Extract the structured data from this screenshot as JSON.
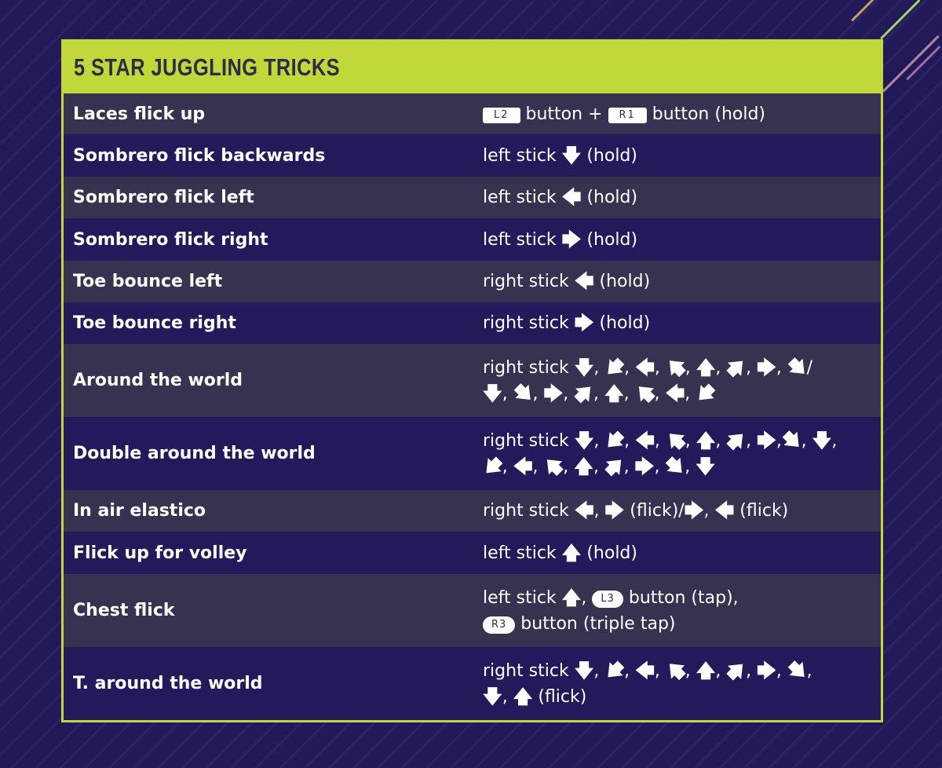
{
  "title": "5 STAR JUGGLING TRICKS",
  "colors": {
    "accent": "#c2d83a",
    "row_odd": "#363250",
    "row_even": "#221a5a",
    "background": "#221a58",
    "title_text": "#2f2c4a"
  },
  "arrows": {
    "down": "🡇",
    "up": "🡅",
    "left": "🡄",
    "right": "🡆",
    "down_left": "🡇",
    "up_left": "🡄",
    "up_right": "🡅",
    "down_right": "🡆"
  },
  "rows": [
    {
      "name": "Laces flick up",
      "input": [
        [
          {
            "t": "btn",
            "v": "L2"
          },
          {
            "t": "txt",
            "v": " button + "
          },
          {
            "t": "btn",
            "v": "R1"
          },
          {
            "t": "txt",
            "v": " button (hold)"
          }
        ]
      ]
    },
    {
      "name": "Sombrero flick backwards",
      "input": [
        [
          {
            "t": "txt",
            "v": "left stick "
          },
          {
            "t": "arr",
            "v": "down"
          },
          {
            "t": "txt",
            "v": " (hold)"
          }
        ]
      ]
    },
    {
      "name": "Sombrero flick left",
      "input": [
        [
          {
            "t": "txt",
            "v": "left stick "
          },
          {
            "t": "arr",
            "v": "left"
          },
          {
            "t": "txt",
            "v": " (hold)"
          }
        ]
      ]
    },
    {
      "name": "Sombrero flick right",
      "input": [
        [
          {
            "t": "txt",
            "v": "left stick "
          },
          {
            "t": "arr",
            "v": "right"
          },
          {
            "t": "txt",
            "v": " (hold)"
          }
        ]
      ]
    },
    {
      "name": "Toe bounce left",
      "input": [
        [
          {
            "t": "txt",
            "v": "right stick "
          },
          {
            "t": "arr",
            "v": "left"
          },
          {
            "t": "txt",
            "v": " (hold)"
          }
        ]
      ]
    },
    {
      "name": "Toe bounce right",
      "input": [
        [
          {
            "t": "txt",
            "v": "right stick "
          },
          {
            "t": "arr",
            "v": "right"
          },
          {
            "t": "txt",
            "v": " (hold)"
          }
        ]
      ]
    },
    {
      "name": "Around the world",
      "input": [
        [
          {
            "t": "txt",
            "v": "right stick "
          },
          {
            "t": "arr",
            "v": "down"
          },
          {
            "t": "txt",
            "v": ", "
          },
          {
            "t": "arr",
            "v": "down_left"
          },
          {
            "t": "txt",
            "v": ", "
          },
          {
            "t": "arr",
            "v": "left"
          },
          {
            "t": "txt",
            "v": ", "
          },
          {
            "t": "arr",
            "v": "up_left"
          },
          {
            "t": "txt",
            "v": ", "
          },
          {
            "t": "arr",
            "v": "up"
          },
          {
            "t": "txt",
            "v": ", "
          },
          {
            "t": "arr",
            "v": "up_right"
          },
          {
            "t": "txt",
            "v": ", "
          },
          {
            "t": "arr",
            "v": "right"
          },
          {
            "t": "txt",
            "v": ", "
          },
          {
            "t": "arr",
            "v": "down_right"
          },
          {
            "t": "txt",
            "v": "/"
          }
        ],
        [
          {
            "t": "arr",
            "v": "down"
          },
          {
            "t": "txt",
            "v": ", "
          },
          {
            "t": "arr",
            "v": "down_right"
          },
          {
            "t": "txt",
            "v": ", "
          },
          {
            "t": "arr",
            "v": "right"
          },
          {
            "t": "txt",
            "v": ", "
          },
          {
            "t": "arr",
            "v": "up_right"
          },
          {
            "t": "txt",
            "v": ", "
          },
          {
            "t": "arr",
            "v": "up"
          },
          {
            "t": "txt",
            "v": ", "
          },
          {
            "t": "arr",
            "v": "up_left"
          },
          {
            "t": "txt",
            "v": ", "
          },
          {
            "t": "arr",
            "v": "left"
          },
          {
            "t": "txt",
            "v": ", "
          },
          {
            "t": "arr",
            "v": "down_left"
          }
        ]
      ]
    },
    {
      "name": "Double around the world",
      "input": [
        [
          {
            "t": "txt",
            "v": "right stick "
          },
          {
            "t": "arr",
            "v": "down"
          },
          {
            "t": "txt",
            "v": ", "
          },
          {
            "t": "arr",
            "v": "down_left"
          },
          {
            "t": "txt",
            "v": ", "
          },
          {
            "t": "arr",
            "v": "left"
          },
          {
            "t": "txt",
            "v": ", "
          },
          {
            "t": "arr",
            "v": "up_left"
          },
          {
            "t": "txt",
            "v": ", "
          },
          {
            "t": "arr",
            "v": "up"
          },
          {
            "t": "txt",
            "v": ", "
          },
          {
            "t": "arr",
            "v": "up_right"
          },
          {
            "t": "txt",
            "v": ", "
          },
          {
            "t": "arr",
            "v": "right"
          },
          {
            "t": "txt",
            "v": ","
          },
          {
            "t": "arr",
            "v": "down_right"
          },
          {
            "t": "txt",
            "v": ", "
          },
          {
            "t": "arr",
            "v": "down"
          },
          {
            "t": "txt",
            "v": ","
          }
        ],
        [
          {
            "t": "arr",
            "v": "down_left"
          },
          {
            "t": "txt",
            "v": ", "
          },
          {
            "t": "arr",
            "v": "left"
          },
          {
            "t": "txt",
            "v": ", "
          },
          {
            "t": "arr",
            "v": "up_left"
          },
          {
            "t": "txt",
            "v": ", "
          },
          {
            "t": "arr",
            "v": "up"
          },
          {
            "t": "txt",
            "v": ", "
          },
          {
            "t": "arr",
            "v": "up_right"
          },
          {
            "t": "txt",
            "v": ", "
          },
          {
            "t": "arr",
            "v": "right"
          },
          {
            "t": "txt",
            "v": ", "
          },
          {
            "t": "arr",
            "v": "down_right"
          },
          {
            "t": "txt",
            "v": ", "
          },
          {
            "t": "arr",
            "v": "down"
          }
        ]
      ]
    },
    {
      "name": "In air elastico",
      "input": [
        [
          {
            "t": "txt",
            "v": "right stick "
          },
          {
            "t": "arr",
            "v": "left"
          },
          {
            "t": "txt",
            "v": ", "
          },
          {
            "t": "arr",
            "v": "right"
          },
          {
            "t": "txt",
            "v": " (flick)/"
          },
          {
            "t": "arr",
            "v": "right"
          },
          {
            "t": "txt",
            "v": ", "
          },
          {
            "t": "arr",
            "v": "left"
          },
          {
            "t": "txt",
            "v": " (flick)"
          }
        ]
      ]
    },
    {
      "name": "Flick up for volley",
      "input": [
        [
          {
            "t": "txt",
            "v": "left stick "
          },
          {
            "t": "arr",
            "v": "up"
          },
          {
            "t": "txt",
            "v": " (hold)"
          }
        ]
      ]
    },
    {
      "name": "Chest flick",
      "input": [
        [
          {
            "t": "txt",
            "v": "left stick "
          },
          {
            "t": "arr",
            "v": "up"
          },
          {
            "t": "txt",
            "v": ", "
          },
          {
            "t": "pill",
            "v": "L3"
          },
          {
            "t": "txt",
            "v": " button (tap),"
          }
        ],
        [
          {
            "t": "pill",
            "v": "R3"
          },
          {
            "t": "txt",
            "v": " button (triple tap)"
          }
        ]
      ]
    },
    {
      "name": "T. around the world",
      "input": [
        [
          {
            "t": "txt",
            "v": "right stick "
          },
          {
            "t": "arr",
            "v": "down"
          },
          {
            "t": "txt",
            "v": ", "
          },
          {
            "t": "arr",
            "v": "down_left"
          },
          {
            "t": "txt",
            "v": ", "
          },
          {
            "t": "arr",
            "v": "left"
          },
          {
            "t": "txt",
            "v": ", "
          },
          {
            "t": "arr",
            "v": "up_left"
          },
          {
            "t": "txt",
            "v": ", "
          },
          {
            "t": "arr",
            "v": "up"
          },
          {
            "t": "txt",
            "v": ", "
          },
          {
            "t": "arr",
            "v": "up_right"
          },
          {
            "t": "txt",
            "v": ", "
          },
          {
            "t": "arr",
            "v": "right"
          },
          {
            "t": "txt",
            "v": ", "
          },
          {
            "t": "arr",
            "v": "down_right"
          },
          {
            "t": "txt",
            "v": ","
          }
        ],
        [
          {
            "t": "arr",
            "v": "down"
          },
          {
            "t": "txt",
            "v": ", "
          },
          {
            "t": "arr",
            "v": "up"
          },
          {
            "t": "txt",
            "v": " (flick)"
          }
        ]
      ]
    }
  ]
}
